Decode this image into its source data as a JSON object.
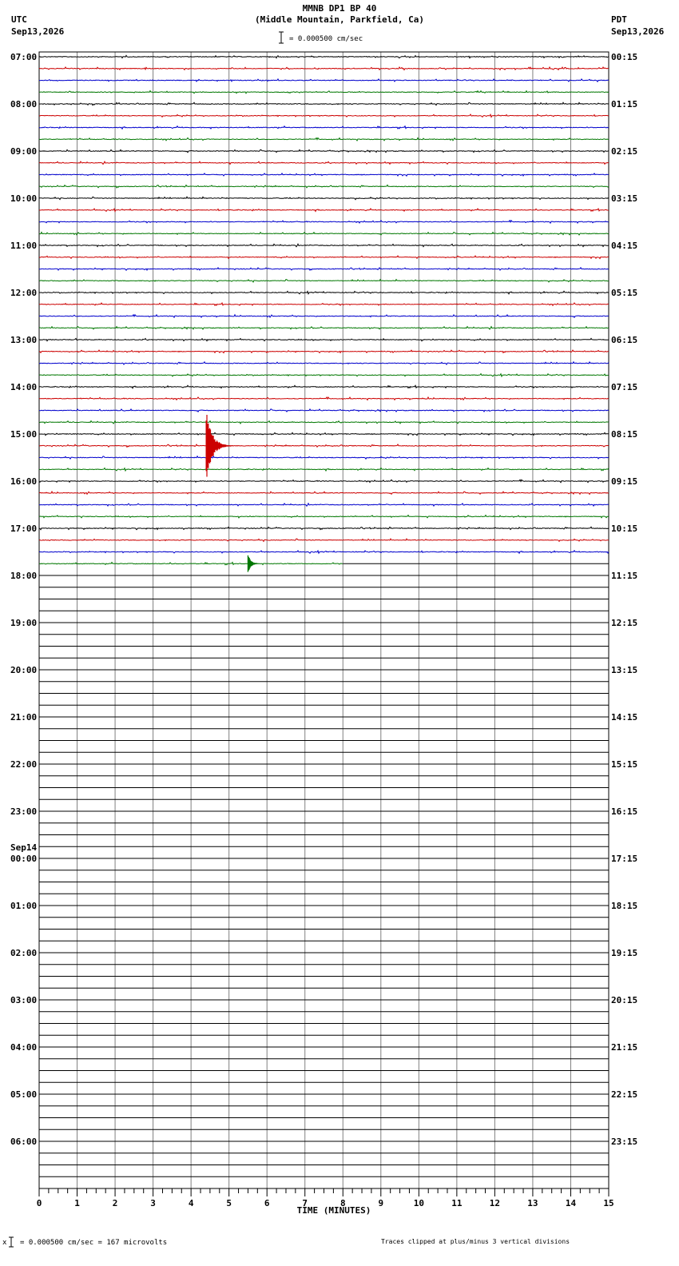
{
  "header": {
    "title": "MMNB DP1 BP 40",
    "subtitle": "(Middle Mountain, Parkfield, Ca)",
    "scale_label": "= 0.000500 cm/sec",
    "left_tz": "UTC",
    "left_date": "Sep13,2026",
    "right_tz": "PDT",
    "right_date": "Sep13,2026"
  },
  "footer": {
    "scale_note": "= 0.000500 cm/sec =     167 microvolts",
    "clip_note": "Traces clipped at plus/minus 3 vertical divisions",
    "corner_mark": "x"
  },
  "chart_data": {
    "type": "line",
    "xlabel": "TIME (MINUTES)",
    "xlim": [
      0,
      15
    ],
    "x_ticks": [
      "0",
      "1",
      "2",
      "3",
      "4",
      "5",
      "6",
      "7",
      "8",
      "9",
      "10",
      "11",
      "12",
      "13",
      "14",
      "15"
    ],
    "rows_per_hour": 4,
    "trace_colors": [
      "#000000",
      "#cc0000",
      "#0000cc",
      "#007700"
    ],
    "grid_color": "#808080",
    "left_labels": [
      "07:00",
      "08:00",
      "09:00",
      "10:00",
      "11:00",
      "12:00",
      "13:00",
      "14:00",
      "15:00",
      "16:00",
      "17:00",
      "18:00",
      "19:00",
      "20:00",
      "21:00",
      "22:00",
      "23:00",
      "00:00",
      "01:00",
      "02:00",
      "03:00",
      "04:00",
      "05:00",
      "06:00"
    ],
    "date_change_label": {
      "index": 17,
      "text": "Sep14"
    },
    "right_labels": [
      "00:15",
      "01:15",
      "02:15",
      "03:15",
      "04:15",
      "05:15",
      "06:15",
      "07:15",
      "08:15",
      "09:15",
      "10:15",
      "11:15",
      "12:15",
      "13:15",
      "14:15",
      "15:15",
      "16:15",
      "17:15",
      "18:15",
      "19:15",
      "20:15",
      "21:15",
      "22:15",
      "23:15"
    ],
    "recorded_rows": 44,
    "last_row_end_minute": 8,
    "events": [
      {
        "row": 33,
        "minute": 4.4,
        "color": "#cc0000",
        "amplitude": "clipped"
      },
      {
        "row": 43,
        "minute": 5.5,
        "color": "#007700",
        "amplitude": "moderate"
      }
    ]
  }
}
